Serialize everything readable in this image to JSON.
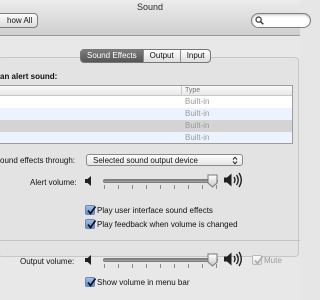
{
  "window": {
    "title": "Sound"
  },
  "toolbar": {
    "show_all_label": "how All",
    "search_value": ""
  },
  "tabs": [
    {
      "label": "Sound Effects",
      "active": true
    },
    {
      "label": "Output",
      "active": false
    },
    {
      "label": "Input",
      "active": false
    }
  ],
  "alert": {
    "heading": "an alert sound:",
    "type_header": "Type",
    "rows": [
      {
        "name": "",
        "type": "Built-in"
      },
      {
        "name": "",
        "type": "Built-in"
      },
      {
        "name": "",
        "type": "Built-in"
      },
      {
        "name": "",
        "type": "Built-in"
      }
    ],
    "selected_row": 2
  },
  "effects": {
    "through_label": "ound effects through:",
    "through_value": "Selected sound output device",
    "alert_volume_label": "Alert volume:",
    "alert_volume_level": 0.93,
    "play_ui_label": "Play user interface sound effects",
    "play_ui_checked": true,
    "play_feedback_label": "Play feedback when volume is changed",
    "play_feedback_checked": true
  },
  "output": {
    "volume_label": "Output volume:",
    "volume_level": 0.93,
    "mute_label": "Mute",
    "mute_checked": false,
    "show_in_menu_label": "Show volume in menu bar",
    "show_in_menu_checked": true
  },
  "icons": {
    "search": "magnifier-icon",
    "speaker_quiet": "speaker-low-icon",
    "speaker_loud": "speaker-high-icon",
    "popup_arrows": "up-down-chevron-icon",
    "check": "checkmark-icon"
  },
  "colors": {
    "checkbox_blue": "#5f8ed0",
    "selected_row": "#d4d4d4",
    "stripe": "#edf3fe"
  }
}
